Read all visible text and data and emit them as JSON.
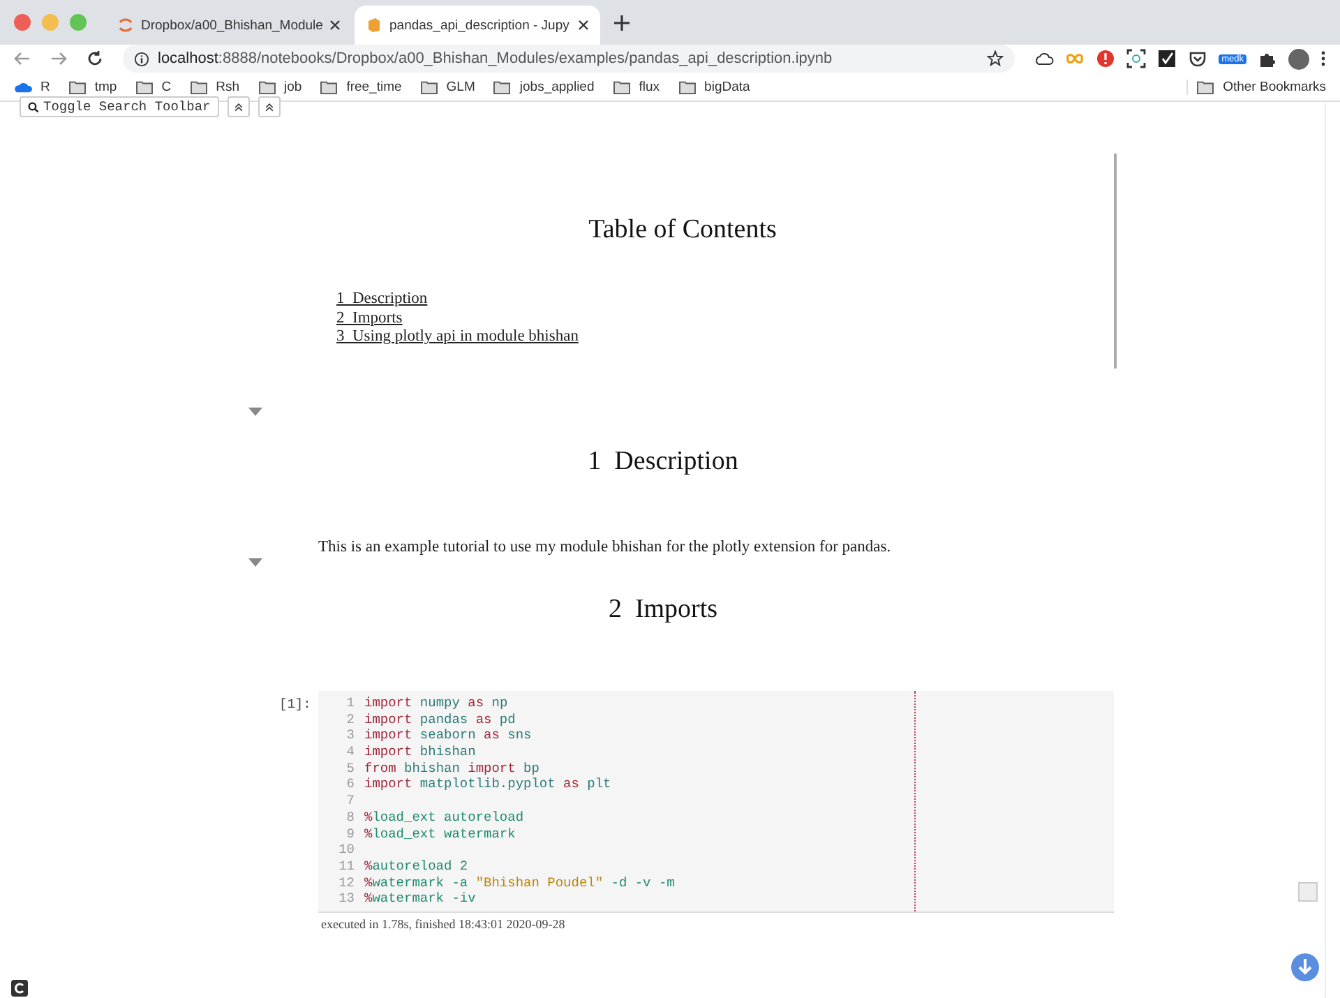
{
  "browser": {
    "tabs": [
      {
        "title": "Dropbox/a00_Bhishan_Module",
        "selected": false,
        "kind": "spinner"
      },
      {
        "title": "pandas_api_description - Jupy",
        "selected": true,
        "kind": "notebook"
      }
    ],
    "url": {
      "host": "localhost",
      "path": ":8888/notebooks/Dropbox/a00_Bhishan_Modules/examples/pandas_api_description.ipynb"
    },
    "extension_badge": "medk",
    "bookmarks": [
      {
        "label": "R",
        "kind": "cloud"
      },
      {
        "label": "tmp",
        "kind": "folder"
      },
      {
        "label": "C",
        "kind": "folder"
      },
      {
        "label": "Rsh",
        "kind": "folder"
      },
      {
        "label": "job",
        "kind": "folder"
      },
      {
        "label": "free_time",
        "kind": "folder"
      },
      {
        "label": "GLM",
        "kind": "folder"
      },
      {
        "label": "jobs_applied",
        "kind": "folder"
      },
      {
        "label": "flux",
        "kind": "folder"
      },
      {
        "label": "bigData",
        "kind": "folder"
      }
    ],
    "other_bookmarks": "Other Bookmarks"
  },
  "notebook": {
    "search_toolbar_button": "Toggle Search Toolbar",
    "toc": {
      "title": "Table of Contents",
      "items": [
        {
          "number": "1",
          "label": "Description"
        },
        {
          "number": "2",
          "label": "Imports"
        },
        {
          "number": "3",
          "label": "Using plotly api in module bhishan"
        }
      ]
    },
    "sections": [
      {
        "number": "1",
        "title": "Description",
        "expanded": true,
        "paragraph": "This is an example tutorial to use my module bhishan for the plotly extension for pandas."
      },
      {
        "number": "2",
        "title": "Imports",
        "expanded": true
      }
    ],
    "code_cell": {
      "prompt": "[1]:",
      "lines": [
        {
          "number": "1",
          "tokens": [
            {
              "text": "import",
              "kind": "keyword"
            },
            {
              "text": " numpy ",
              "kind": "name"
            },
            {
              "text": "as",
              "kind": "keyword"
            },
            {
              "text": " np",
              "kind": "name"
            }
          ]
        },
        {
          "number": "2",
          "tokens": [
            {
              "text": "import",
              "kind": "keyword"
            },
            {
              "text": " pandas ",
              "kind": "name"
            },
            {
              "text": "as",
              "kind": "keyword"
            },
            {
              "text": " pd",
              "kind": "name"
            }
          ]
        },
        {
          "number": "3",
          "tokens": [
            {
              "text": "import",
              "kind": "keyword"
            },
            {
              "text": " seaborn ",
              "kind": "name"
            },
            {
              "text": "as",
              "kind": "keyword"
            },
            {
              "text": " sns",
              "kind": "name"
            }
          ]
        },
        {
          "number": "4",
          "tokens": [
            {
              "text": "import",
              "kind": "keyword"
            },
            {
              "text": " bhishan",
              "kind": "name"
            }
          ]
        },
        {
          "number": "5",
          "tokens": [
            {
              "text": "from",
              "kind": "keyword"
            },
            {
              "text": " bhishan ",
              "kind": "name"
            },
            {
              "text": "import",
              "kind": "keyword"
            },
            {
              "text": " bp",
              "kind": "name"
            }
          ]
        },
        {
          "number": "6",
          "tokens": [
            {
              "text": "import",
              "kind": "keyword"
            },
            {
              "text": " matplotlib.pyplot ",
              "kind": "name"
            },
            {
              "text": "as",
              "kind": "keyword"
            },
            {
              "text": " plt",
              "kind": "name"
            }
          ]
        },
        {
          "number": "7"
        },
        {
          "number": "8",
          "tokens": [
            {
              "text": "%",
              "kind": "operator"
            },
            {
              "text": "load_ext autoreload",
              "kind": "magic"
            }
          ]
        },
        {
          "number": "9",
          "tokens": [
            {
              "text": "%",
              "kind": "operator"
            },
            {
              "text": "load_ext watermark",
              "kind": "magic"
            }
          ]
        },
        {
          "number": "10"
        },
        {
          "number": "11",
          "tokens": [
            {
              "text": "%",
              "kind": "operator"
            },
            {
              "text": "autoreload 2",
              "kind": "magic"
            }
          ]
        },
        {
          "number": "12",
          "tokens": [
            {
              "text": "%",
              "kind": "operator"
            },
            {
              "text": "watermark -a ",
              "kind": "magic"
            },
            {
              "text": "\"Bhishan Poudel\"",
              "kind": "string"
            },
            {
              "text": " -d -v -m",
              "kind": "magic"
            }
          ]
        },
        {
          "number": "13",
          "tokens": [
            {
              "text": "%",
              "kind": "operator"
            },
            {
              "text": "watermark -iv",
              "kind": "magic"
            }
          ]
        }
      ],
      "execution_info": "executed in 1.78s, finished 18:43:01 2020-09-28"
    }
  }
}
